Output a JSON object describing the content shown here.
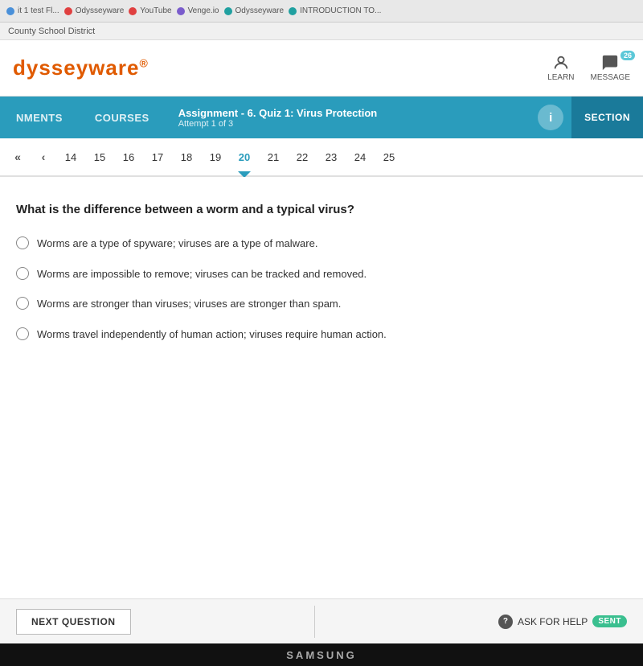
{
  "browser": {
    "tabs": [
      {
        "label": "it 1 test Fl...",
        "dot_class": "dot-blue",
        "icon": "●"
      },
      {
        "label": "Odysseyware",
        "dot_class": "dot-red",
        "icon": "●"
      },
      {
        "label": "YouTube",
        "dot_class": "dot-red",
        "icon": "●"
      },
      {
        "label": "Venge.io",
        "dot_class": "dot-purple",
        "icon": "●"
      },
      {
        "label": "Odysseyware",
        "dot_class": "dot-teal",
        "icon": "●"
      },
      {
        "label": "INTRODUCTION TO...",
        "dot_class": "dot-teal",
        "icon": "●"
      }
    ]
  },
  "county_bar": {
    "label": "County School District"
  },
  "header": {
    "logo": "dysseyware",
    "learn_label": "LEARN",
    "message_label": "MESSAGE",
    "message_count": "26"
  },
  "nav": {
    "assignments_label": "NMENTS",
    "courses_label": "COURSES",
    "assignment_label": "Assignment",
    "assignment_name": "- 6. Quiz 1: Virus Protection",
    "attempt_label": "Attempt 1 of 3",
    "info_icon": "i",
    "section_label": "SECTION"
  },
  "pagination": {
    "pages": [
      "14",
      "15",
      "16",
      "17",
      "18",
      "19",
      "20",
      "21",
      "22",
      "23",
      "24",
      "25"
    ],
    "active_page": "20"
  },
  "question": {
    "text": "What is the difference between a worm and a typical virus?",
    "options": [
      "Worms are a type of spyware; viruses are a type of malware.",
      "Worms are impossible to remove; viruses can be tracked and removed.",
      "Worms are stronger than viruses; viruses are stronger than spam.",
      "Worms travel independently of human action; viruses require human action."
    ]
  },
  "footer": {
    "next_button_label": "NEXT QUESTION",
    "ask_help_label": "ASK FOR HELP",
    "sent_label": "SENT"
  },
  "taskbar": {
    "brand": "SAMSUNG"
  }
}
